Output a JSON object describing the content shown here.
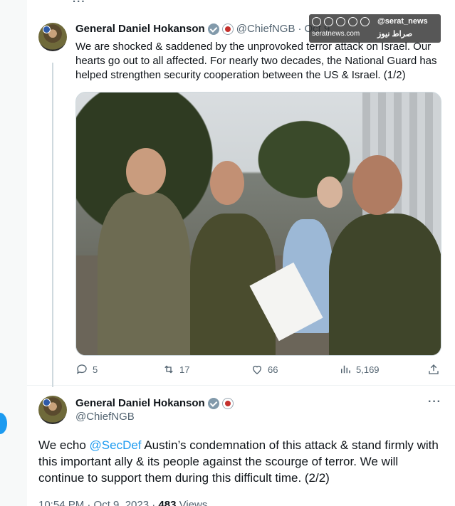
{
  "top_partial": "...",
  "tweet1": {
    "name": "General Daniel Hokanson",
    "handle": "@ChiefNGB",
    "separator": "·",
    "date": "Oct 9",
    "text": "We are shocked & saddened by the unprovoked terror attack on Israel. Our hearts go out to all affected. For nearly two decades, the National Guard has helped strengthen security cooperation between the US & Israel. (1/2)",
    "actions": {
      "replies": "5",
      "reposts": "17",
      "likes": "66",
      "views": "5,169"
    }
  },
  "tweet2": {
    "name": "General Daniel Hokanson",
    "handle": "@ChiefNGB",
    "more": "···",
    "text_before": "We echo ",
    "mention": "@SecDef",
    "text_after": " Austin’s condemnation of this attack & stand firmly with this important ally & its people against the scourge of terror. We will continue to support them during this difficult time. (2/2)",
    "timestamp": "10:54 PM · Oct 9, 2023 · ",
    "views_count": "483",
    "views_label": " Views"
  },
  "watermark": {
    "handle": "@serat_news",
    "site": "seratnews.com",
    "brand": "صراط نيوز"
  },
  "colors": {
    "accent": "#1d9bf0",
    "muted": "#536471",
    "text": "#0f1419"
  }
}
